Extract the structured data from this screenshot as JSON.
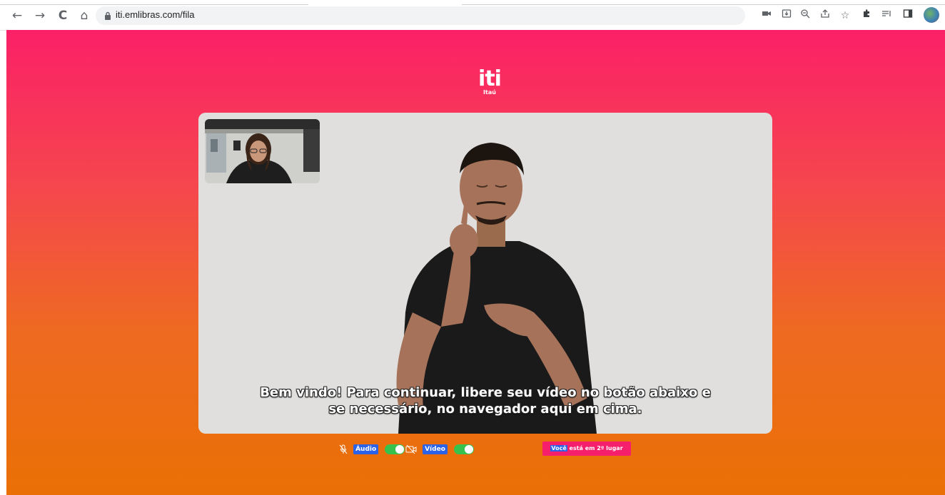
{
  "browser": {
    "url": "iti.emlibras.com/fila",
    "nav": {
      "back": "←",
      "forward": "→",
      "reload": "C",
      "home": "⌂"
    },
    "right_icons": [
      "camera-icon",
      "install-icon",
      "zoom-icon",
      "share-icon",
      "star-icon",
      "extensions-icon",
      "reading-list-icon",
      "side-panel-icon"
    ]
  },
  "logo": {
    "brand": "iti",
    "sub": "Itaú"
  },
  "video": {
    "caption_line1": "Bem vindo! Para continuar, libere seu vídeo no botão abaixo e",
    "caption_line2": "se necessário, no navegador aqui em cima."
  },
  "controls": {
    "audio_label": "Áudio",
    "audio_on": true,
    "video_label": "Vídeo",
    "video_on": true
  },
  "queue": {
    "highlight": "Você",
    "text": " está em 2º lugar"
  },
  "colors": {
    "gradient_top": "#fb2068",
    "gradient_bottom": "#ea7005",
    "toggle_on": "#37c24e",
    "label_blue": "#2c63e6",
    "queue_pink": "#f61f6b"
  }
}
